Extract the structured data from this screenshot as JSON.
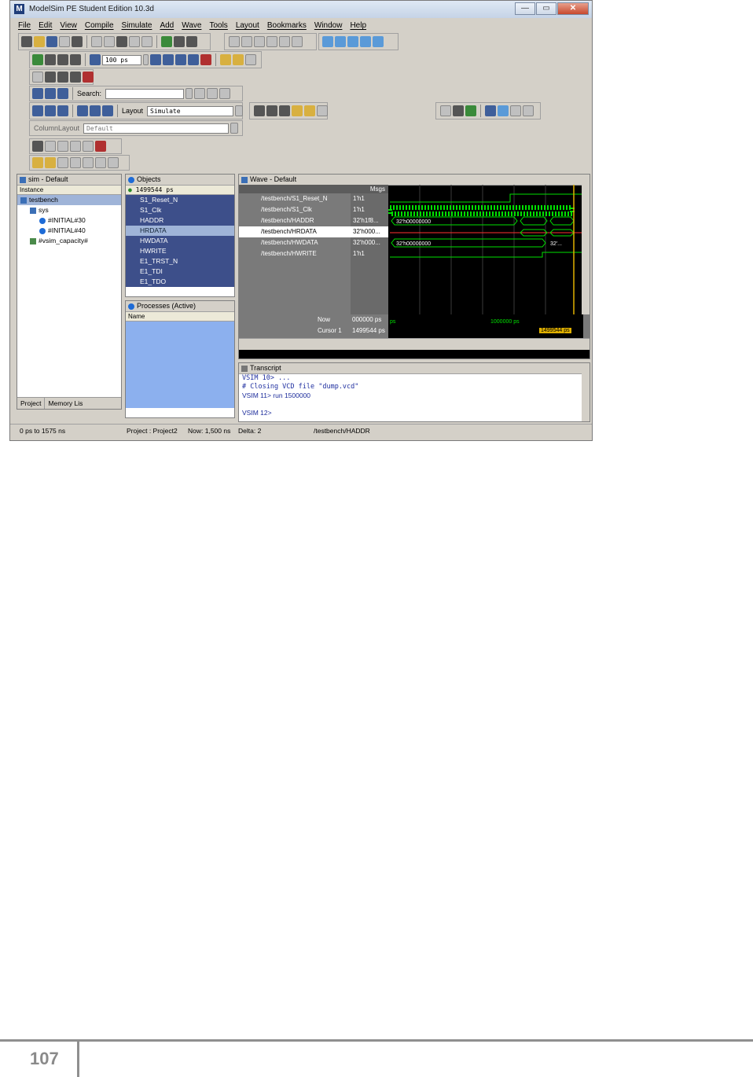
{
  "window": {
    "title": "ModelSim PE Student Edition 10.3d",
    "logo": "M",
    "minimize": "—",
    "maximize": "▭",
    "close": "✕"
  },
  "menu": [
    "File",
    "Edit",
    "View",
    "Compile",
    "Simulate",
    "Add",
    "Wave",
    "Tools",
    "Layout",
    "Bookmarks",
    "Window",
    "Help"
  ],
  "toolbar": {
    "run_length": "100 ps",
    "search_label": "Search:",
    "layout_label": "Layout",
    "layout_value": "Simulate",
    "column_layout_label": "ColumnLayout",
    "column_layout_value": "Default"
  },
  "sim_panel": {
    "title": "sim - Default",
    "column": "Instance",
    "items": [
      "testbench",
      "sys",
      "#INITIAL#30",
      "#INITIAL#40",
      "#vsim_capacity#"
    ],
    "tabs": [
      "Project",
      "Memory Lis"
    ]
  },
  "objects_panel": {
    "title": "Objects",
    "time": "1499544 ps",
    "items": [
      "S1_Reset_N",
      "S1_Clk",
      "HADDR",
      "HRDATA",
      "HWDATA",
      "HWRITE",
      "E1_TRST_N",
      "E1_TDI",
      "E1_TDO"
    ]
  },
  "processes_panel": {
    "title": "Processes (Active)",
    "column": "Name"
  },
  "wave_panel": {
    "title": "Wave - Default",
    "msgs_header": "Msgs",
    "signals": [
      "/testbench/S1_Reset_N",
      "/testbench/S1_Clk",
      "/testbench/HADDR",
      "/testbench/HRDATA",
      "/testbench/HWDATA",
      "/testbench/HWRITE"
    ],
    "values": [
      "1'h1",
      "1'h1",
      "32'h1f8...",
      "32'h000...",
      "32'h000...",
      "1'h1"
    ],
    "bus_labels": [
      "32'h00000000",
      "32'h00000000"
    ],
    "bus_tail": "32'...",
    "now_label": "Now",
    "now_value": "000000 ps",
    "cursor_label": "Cursor 1",
    "cursor_value": "1499544 ps",
    "ruler_start": "ps",
    "ruler_mark": "1000000 ps",
    "cursor_tag": "1499544 ps"
  },
  "transcript": {
    "title": "Transcript",
    "lines": [
      "VSIM 10> ...",
      "# Closing VCD file \"dump.vcd\"",
      "VSIM 11> run 1500000",
      "",
      "VSIM 12>"
    ]
  },
  "statusbar": {
    "range": "0 ps to 1575 ns",
    "project": "Project : Project2",
    "now": "Now: 1,500 ns",
    "delta": "Delta: 2",
    "path": "/testbench/HADDR"
  },
  "page": {
    "number": "107"
  },
  "colors": {
    "wave_green": "#00e000",
    "cursor_yellow": "#e0b000",
    "wave_red": "#ff3030"
  }
}
